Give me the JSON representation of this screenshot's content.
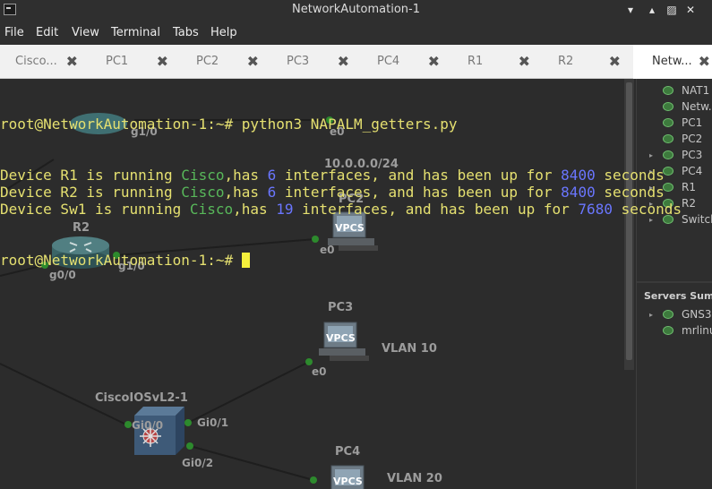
{
  "window": {
    "title": "NetworkAutomation-1"
  },
  "menu": [
    "File",
    "Edit",
    "View",
    "Terminal",
    "Tabs",
    "Help"
  ],
  "tabs": [
    {
      "label": "Cisco..."
    },
    {
      "label": "PC1"
    },
    {
      "label": "PC2"
    },
    {
      "label": "PC3"
    },
    {
      "label": "PC4"
    },
    {
      "label": "R1"
    },
    {
      "label": "R2"
    },
    {
      "label": "Netw..."
    }
  ],
  "active_tab": 7,
  "terminal": {
    "prompt": "root@NetworkAutomation-1:~#",
    "command": "python3 NAPALM_getters.py",
    "lines": [
      {
        "pre": "Device R1 is running ",
        "vendor": "Cisco",
        "mid": ",has ",
        "ifaces": "6",
        "post": " interfaces, and has been up for ",
        "uptime": "8400",
        "unit": " seconds"
      },
      {
        "pre": "Device R2 is running ",
        "vendor": "Cisco",
        "mid": ",has ",
        "ifaces": "6",
        "post": " interfaces, and has been up for ",
        "uptime": "8400",
        "unit": " seconds"
      },
      {
        "pre": "Device Sw1 is running ",
        "vendor": "Cisco",
        "mid": ",has ",
        "ifaces": "19",
        "post": " interfaces, and has been up for ",
        "uptime": "7680",
        "unit": " seconds"
      }
    ]
  },
  "topology": {
    "nodes": {
      "r2": "R2",
      "pc2": "PC2",
      "pc3": "PC3",
      "pc4": "PC4",
      "switch": "CiscoIOSvL2-1",
      "subnet": "10.0.0.0/24",
      "vlan10": "VLAN 10",
      "vlan20": "VLAN 20",
      "vpcs": "VPCS"
    },
    "ports": {
      "r2_g00": "g0/0",
      "r2_g10": "g1/0",
      "pc2_e0": "e0",
      "pc3_e0": "e0",
      "sw_gi00": "Gi0/0",
      "sw_gi01": "Gi0/1",
      "sw_gi02": "Gi0/2",
      "hidden_g10": "g1/0",
      "hidden_e0": "e0"
    }
  },
  "sidebar": {
    "devices": [
      {
        "label": "NAT1",
        "expand": false
      },
      {
        "label": "Netw...",
        "expand": false
      },
      {
        "label": "PC1",
        "expand": false
      },
      {
        "label": "PC2",
        "expand": false
      },
      {
        "label": "PC3",
        "expand": true
      },
      {
        "label": "PC4",
        "expand": true
      },
      {
        "label": "R1",
        "expand": true
      },
      {
        "label": "R2",
        "expand": true
      },
      {
        "label": "Switch",
        "expand": true
      }
    ],
    "servers_header": "Servers Summa...",
    "servers": [
      {
        "label": "GNS3",
        "expand": true
      },
      {
        "label": "mrlinu",
        "expand": false
      }
    ]
  },
  "colors": {
    "terminal_text": "#e5e070",
    "vendor_text": "#58b85a",
    "number_text": "#6a76ff",
    "cursor": "#f4ef3c",
    "status_green": "#3d7a3d"
  }
}
